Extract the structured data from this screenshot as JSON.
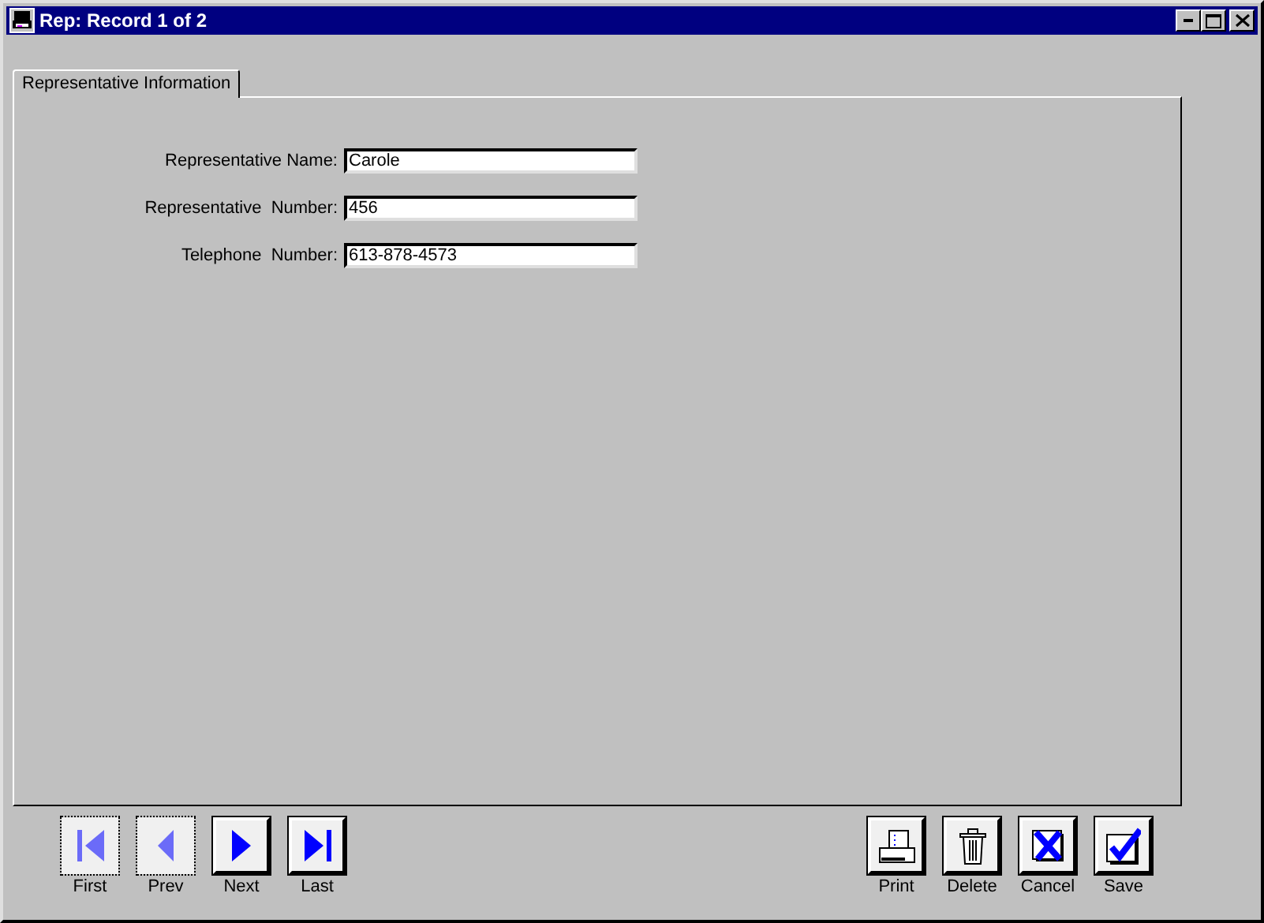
{
  "window": {
    "title": "Rep: Record 1 of 2"
  },
  "tabs": [
    {
      "label": "Representative Information",
      "selected": true
    }
  ],
  "fields": [
    {
      "label": "Representative Name:",
      "value": "Carole"
    },
    {
      "label": "Representative  Number:",
      "value": "456"
    },
    {
      "label": "Telephone  Number:",
      "value": "613-878-4573"
    }
  ],
  "navigation": [
    {
      "kind": "first",
      "label": "First",
      "disabled": true
    },
    {
      "kind": "prev",
      "label": "Prev",
      "disabled": true
    },
    {
      "kind": "next",
      "label": "Next",
      "disabled": false
    },
    {
      "kind": "last",
      "label": "Last",
      "disabled": false
    }
  ],
  "actions": [
    {
      "kind": "print",
      "label": "Print"
    },
    {
      "kind": "delete",
      "label": "Delete"
    },
    {
      "kind": "cancel",
      "label": "Cancel"
    },
    {
      "kind": "save",
      "label": "Save"
    }
  ]
}
